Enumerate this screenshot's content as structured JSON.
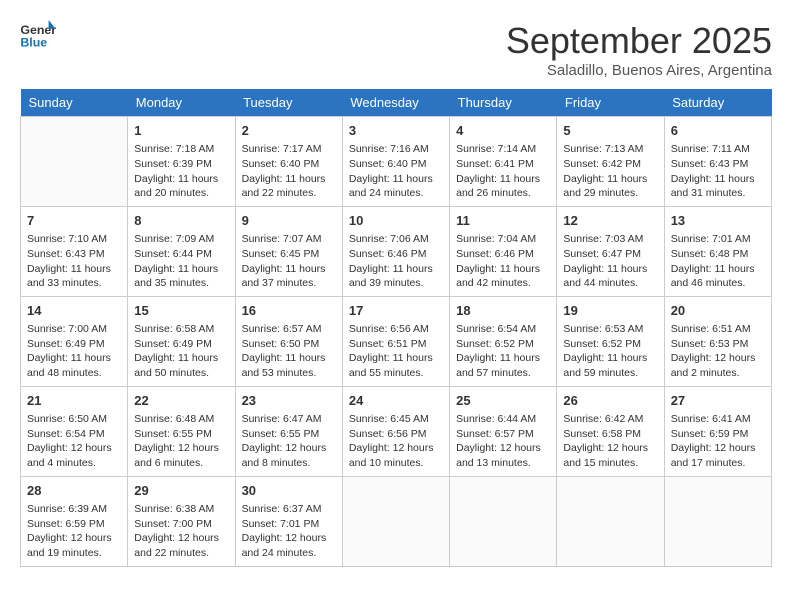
{
  "header": {
    "logo_line1": "General",
    "logo_line2": "Blue",
    "month": "September 2025",
    "location": "Saladillo, Buenos Aires, Argentina"
  },
  "days_of_week": [
    "Sunday",
    "Monday",
    "Tuesday",
    "Wednesday",
    "Thursday",
    "Friday",
    "Saturday"
  ],
  "weeks": [
    [
      {
        "num": "",
        "sunrise": "",
        "sunset": "",
        "daylight": ""
      },
      {
        "num": "1",
        "sunrise": "Sunrise: 7:18 AM",
        "sunset": "Sunset: 6:39 PM",
        "daylight": "Daylight: 11 hours and 20 minutes."
      },
      {
        "num": "2",
        "sunrise": "Sunrise: 7:17 AM",
        "sunset": "Sunset: 6:40 PM",
        "daylight": "Daylight: 11 hours and 22 minutes."
      },
      {
        "num": "3",
        "sunrise": "Sunrise: 7:16 AM",
        "sunset": "Sunset: 6:40 PM",
        "daylight": "Daylight: 11 hours and 24 minutes."
      },
      {
        "num": "4",
        "sunrise": "Sunrise: 7:14 AM",
        "sunset": "Sunset: 6:41 PM",
        "daylight": "Daylight: 11 hours and 26 minutes."
      },
      {
        "num": "5",
        "sunrise": "Sunrise: 7:13 AM",
        "sunset": "Sunset: 6:42 PM",
        "daylight": "Daylight: 11 hours and 29 minutes."
      },
      {
        "num": "6",
        "sunrise": "Sunrise: 7:11 AM",
        "sunset": "Sunset: 6:43 PM",
        "daylight": "Daylight: 11 hours and 31 minutes."
      }
    ],
    [
      {
        "num": "7",
        "sunrise": "Sunrise: 7:10 AM",
        "sunset": "Sunset: 6:43 PM",
        "daylight": "Daylight: 11 hours and 33 minutes."
      },
      {
        "num": "8",
        "sunrise": "Sunrise: 7:09 AM",
        "sunset": "Sunset: 6:44 PM",
        "daylight": "Daylight: 11 hours and 35 minutes."
      },
      {
        "num": "9",
        "sunrise": "Sunrise: 7:07 AM",
        "sunset": "Sunset: 6:45 PM",
        "daylight": "Daylight: 11 hours and 37 minutes."
      },
      {
        "num": "10",
        "sunrise": "Sunrise: 7:06 AM",
        "sunset": "Sunset: 6:46 PM",
        "daylight": "Daylight: 11 hours and 39 minutes."
      },
      {
        "num": "11",
        "sunrise": "Sunrise: 7:04 AM",
        "sunset": "Sunset: 6:46 PM",
        "daylight": "Daylight: 11 hours and 42 minutes."
      },
      {
        "num": "12",
        "sunrise": "Sunrise: 7:03 AM",
        "sunset": "Sunset: 6:47 PM",
        "daylight": "Daylight: 11 hours and 44 minutes."
      },
      {
        "num": "13",
        "sunrise": "Sunrise: 7:01 AM",
        "sunset": "Sunset: 6:48 PM",
        "daylight": "Daylight: 11 hours and 46 minutes."
      }
    ],
    [
      {
        "num": "14",
        "sunrise": "Sunrise: 7:00 AM",
        "sunset": "Sunset: 6:49 PM",
        "daylight": "Daylight: 11 hours and 48 minutes."
      },
      {
        "num": "15",
        "sunrise": "Sunrise: 6:58 AM",
        "sunset": "Sunset: 6:49 PM",
        "daylight": "Daylight: 11 hours and 50 minutes."
      },
      {
        "num": "16",
        "sunrise": "Sunrise: 6:57 AM",
        "sunset": "Sunset: 6:50 PM",
        "daylight": "Daylight: 11 hours and 53 minutes."
      },
      {
        "num": "17",
        "sunrise": "Sunrise: 6:56 AM",
        "sunset": "Sunset: 6:51 PM",
        "daylight": "Daylight: 11 hours and 55 minutes."
      },
      {
        "num": "18",
        "sunrise": "Sunrise: 6:54 AM",
        "sunset": "Sunset: 6:52 PM",
        "daylight": "Daylight: 11 hours and 57 minutes."
      },
      {
        "num": "19",
        "sunrise": "Sunrise: 6:53 AM",
        "sunset": "Sunset: 6:52 PM",
        "daylight": "Daylight: 11 hours and 59 minutes."
      },
      {
        "num": "20",
        "sunrise": "Sunrise: 6:51 AM",
        "sunset": "Sunset: 6:53 PM",
        "daylight": "Daylight: 12 hours and 2 minutes."
      }
    ],
    [
      {
        "num": "21",
        "sunrise": "Sunrise: 6:50 AM",
        "sunset": "Sunset: 6:54 PM",
        "daylight": "Daylight: 12 hours and 4 minutes."
      },
      {
        "num": "22",
        "sunrise": "Sunrise: 6:48 AM",
        "sunset": "Sunset: 6:55 PM",
        "daylight": "Daylight: 12 hours and 6 minutes."
      },
      {
        "num": "23",
        "sunrise": "Sunrise: 6:47 AM",
        "sunset": "Sunset: 6:55 PM",
        "daylight": "Daylight: 12 hours and 8 minutes."
      },
      {
        "num": "24",
        "sunrise": "Sunrise: 6:45 AM",
        "sunset": "Sunset: 6:56 PM",
        "daylight": "Daylight: 12 hours and 10 minutes."
      },
      {
        "num": "25",
        "sunrise": "Sunrise: 6:44 AM",
        "sunset": "Sunset: 6:57 PM",
        "daylight": "Daylight: 12 hours and 13 minutes."
      },
      {
        "num": "26",
        "sunrise": "Sunrise: 6:42 AM",
        "sunset": "Sunset: 6:58 PM",
        "daylight": "Daylight: 12 hours and 15 minutes."
      },
      {
        "num": "27",
        "sunrise": "Sunrise: 6:41 AM",
        "sunset": "Sunset: 6:59 PM",
        "daylight": "Daylight: 12 hours and 17 minutes."
      }
    ],
    [
      {
        "num": "28",
        "sunrise": "Sunrise: 6:39 AM",
        "sunset": "Sunset: 6:59 PM",
        "daylight": "Daylight: 12 hours and 19 minutes."
      },
      {
        "num": "29",
        "sunrise": "Sunrise: 6:38 AM",
        "sunset": "Sunset: 7:00 PM",
        "daylight": "Daylight: 12 hours and 22 minutes."
      },
      {
        "num": "30",
        "sunrise": "Sunrise: 6:37 AM",
        "sunset": "Sunset: 7:01 PM",
        "daylight": "Daylight: 12 hours and 24 minutes."
      },
      {
        "num": "",
        "sunrise": "",
        "sunset": "",
        "daylight": ""
      },
      {
        "num": "",
        "sunrise": "",
        "sunset": "",
        "daylight": ""
      },
      {
        "num": "",
        "sunrise": "",
        "sunset": "",
        "daylight": ""
      },
      {
        "num": "",
        "sunrise": "",
        "sunset": "",
        "daylight": ""
      }
    ]
  ]
}
